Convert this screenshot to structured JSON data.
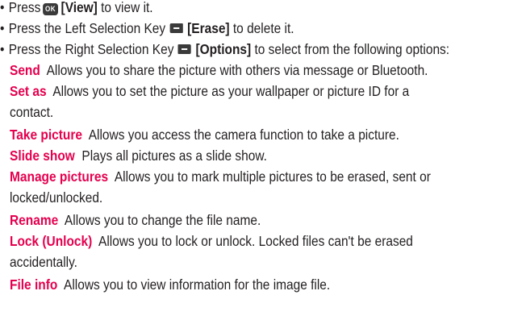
{
  "icons": {
    "ok_key": "ok-key-icon",
    "left_key": "left-selection-key-icon",
    "right_key": "right-selection-key-icon"
  },
  "ok_key_label": "OK",
  "bullets": [
    {
      "pre": "Press",
      "key_label": "[View]",
      "post": "to view it."
    },
    {
      "pre": "Press the Left Selection Key",
      "key_label": "[Erase]",
      "post": "to delete it."
    },
    {
      "pre": "Press the Right Selection Key",
      "key_label": "[Options]",
      "post": "to select from the following options:"
    }
  ],
  "options": [
    {
      "term": "Send",
      "desc": "Allows you to share the picture with others via message or Bluetooth."
    },
    {
      "term": "Set as",
      "desc": "Allows you to set the picture as your wallpaper or picture ID for a",
      "cont": "contact."
    },
    {
      "term": "Take picture",
      "desc": "Allows you access the camera function to take a picture."
    },
    {
      "term": "Slide show",
      "desc": "Plays all pictures as a slide show."
    },
    {
      "term": "Manage pictures",
      "desc": "Allows you to mark multiple pictures to be erased, sent or",
      "cont": "locked/unlocked."
    },
    {
      "term": "Rename",
      "desc": "Allows you to change the file name."
    },
    {
      "term": "Lock (Unlock)",
      "desc": "Allows you to lock or unlock. Locked files can't be erased",
      "cont": "accidentally."
    },
    {
      "term": "File info",
      "desc": "Allows you to view information for the image file."
    }
  ]
}
